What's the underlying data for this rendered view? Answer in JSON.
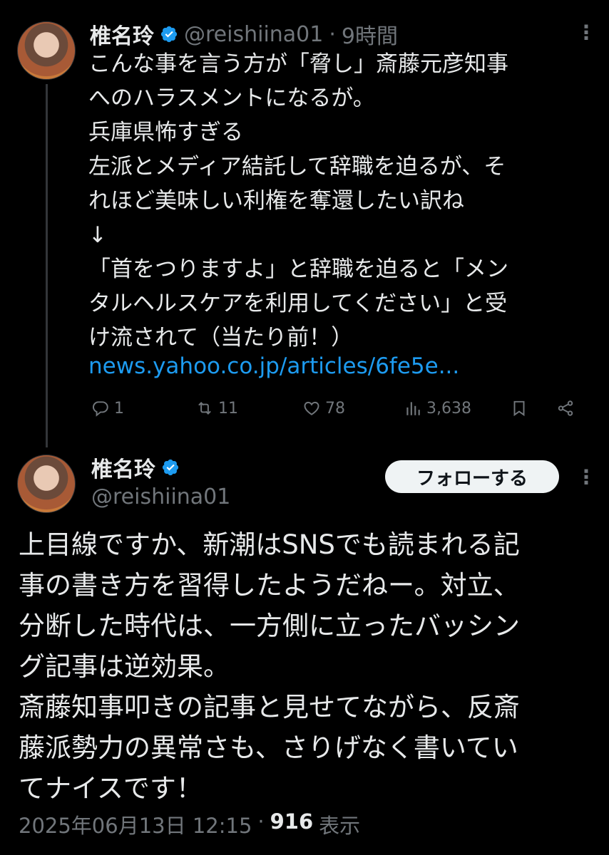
{
  "reply_tweet": {
    "author_name": "椎名玲",
    "handle": "@reishiina01",
    "separator": "·",
    "time_ago": "9時間",
    "text": "こんな事を言う方が「脅し」斎藤元彦知事\nへのハラスメントになるが。\n兵庫県怖すぎる\n左派とメディア結託して辞職を迫るが、そ\nれほど美味しい利権を奪還したい訳ね\n↓\n「首をつりますよ」と辞職を迫ると「メン\nタルヘルスケアを利用してください」と受\nけ流されて（当たり前！）",
    "link": "news.yahoo.co.jp/articles/6fe5e...",
    "stats": {
      "replies": "1",
      "retweets": "11",
      "likes": "78",
      "views": "3,638"
    },
    "icons": [
      "reply-icon",
      "retweet-icon",
      "like-icon",
      "views-icon",
      "bookmark-icon",
      "share-icon",
      "more-icon",
      "verified-icon"
    ]
  },
  "main_tweet": {
    "author_name": "椎名玲",
    "handle": "@reishiina01",
    "follow_label": "フォローする",
    "text": "上目線ですか、新潮はSNSでも読まれる記\n事の書き方を習得したようだねー。対立、\n分断した時代は、一方側に立ったバッシン\nグ記事は逆効果。\n斎藤知事叩きの記事と見せてながら、反斎\n藤派勢力の異常さも、さりげなく書いてい\nてナイスです！",
    "timestamp": "2025年06月13日 12:15",
    "separator": "·",
    "view_count": "916",
    "view_label": "表示"
  },
  "colors": {
    "background": "#000000",
    "text": "#e7e9ea",
    "secondary": "#71767b",
    "link": "#1d9bf0",
    "verified": "#1d9bf0"
  }
}
